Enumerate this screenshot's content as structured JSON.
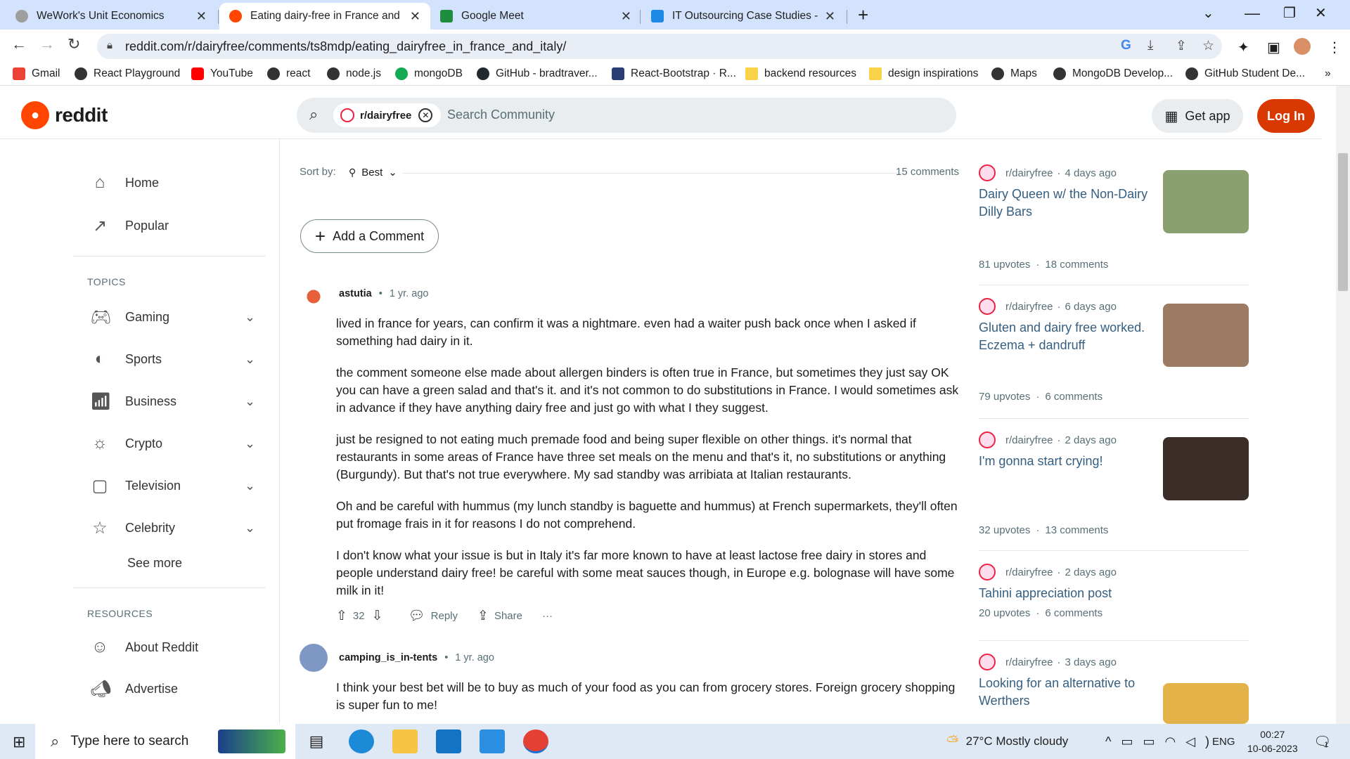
{
  "browser": {
    "tabs": [
      {
        "title": "WeWork's Unit Economics"
      },
      {
        "title": "Eating dairy-free in France and It"
      },
      {
        "title": "Google Meet"
      },
      {
        "title": "IT Outsourcing Case Studies - US"
      }
    ],
    "url": "reddit.com/r/dairyfree/comments/ts8mdp/eating_dairyfree_in_france_and_italy/",
    "bookmarks": [
      "Gmail",
      "React Playground",
      "YouTube",
      "react",
      "node.js",
      "mongoDB",
      "GitHub - bradtraver...",
      "React-Bootstrap · R...",
      "backend resources",
      "design inspirations",
      "Maps",
      "MongoDB Develop...",
      "GitHub Student De..."
    ]
  },
  "header": {
    "logo": "reddit",
    "community_chip": "r/dairyfree",
    "search_placeholder": "Search Community",
    "get_app": "Get app",
    "login": "Log In"
  },
  "sidebar": {
    "main": [
      {
        "label": "Home"
      },
      {
        "label": "Popular"
      }
    ],
    "topics_heading": "TOPICS",
    "topics": [
      {
        "label": "Gaming"
      },
      {
        "label": "Sports"
      },
      {
        "label": "Business"
      },
      {
        "label": "Crypto"
      },
      {
        "label": "Television"
      },
      {
        "label": "Celebrity"
      }
    ],
    "see_more": "See more",
    "resources_heading": "RESOURCES",
    "resources": [
      {
        "label": "About Reddit"
      },
      {
        "label": "Advertise"
      }
    ]
  },
  "thread": {
    "sort_label": "Sort by:",
    "sort_value": "Best",
    "comment_count": "15 comments",
    "add_comment": "Add a Comment",
    "comments": [
      {
        "author": "astutia",
        "time": "1 yr. ago",
        "paragraphs": [
          "lived in france for years, can confirm it was a nightmare. even had a waiter push back once when I asked if something had dairy in it.",
          "the comment someone else made about allergen binders is often true in France, but sometimes they just say OK you can have a green salad and that's it. and it's not common to do substitutions in France. I would sometimes ask in advance if they have anything dairy free and just go with what I they suggest.",
          "just be resigned to not eating much premade food and being super flexible on other things. it's normal that restaurants in some areas of France have three set meals on the menu and that's it, no substitutions or anything (Burgundy). But that's not true everywhere. My sad standby was arribiata at Italian restaurants.",
          "Oh and be careful with hummus (my lunch standby is baguette and hummus) at French supermarkets, they'll often put fromage frais in it for reasons I do not comprehend.",
          "I don't know what your issue is but in Italy it's far more known to have at least lactose free dairy in stores and people understand dairy free! be careful with some meat sauces though, in Europe e.g. bolognase will have some milk in it!"
        ],
        "votes": "32",
        "reply": "Reply",
        "share": "Share",
        "more": "···"
      },
      {
        "author": "camping_is_in-tents",
        "time": "1 yr. ago",
        "paragraphs": [
          "I think your best bet will be to buy as much of your food as you can from grocery stores. Foreign grocery shopping is super fun to me!"
        ]
      }
    ]
  },
  "related": [
    {
      "sub": "r/dairyfree",
      "time": "4 days ago",
      "title": "Dairy Queen w/ the Non-Dairy Dilly Bars",
      "upvotes": "81 upvotes",
      "comments": "18 comments",
      "thumb": "#8aa070"
    },
    {
      "sub": "r/dairyfree",
      "time": "6 days ago",
      "title": "Gluten and dairy free worked. Eczema + dandruff",
      "upvotes": "79 upvotes",
      "comments": "6 comments",
      "thumb": "#9b7b64"
    },
    {
      "sub": "r/dairyfree",
      "time": "2 days ago",
      "title": "I'm gonna start crying!",
      "upvotes": "32 upvotes",
      "comments": "13 comments",
      "thumb": "#3b2e28"
    },
    {
      "sub": "r/dairyfree",
      "time": "2 days ago",
      "title": "Tahini appreciation post",
      "upvotes": "20 upvotes",
      "comments": "6 comments",
      "thumb": ""
    },
    {
      "sub": "r/dairyfree",
      "time": "3 days ago",
      "title": "Looking for an alternative to Werthers",
      "upvotes": "",
      "comments": "",
      "thumb": "#e3b34a"
    }
  ],
  "taskbar": {
    "search_placeholder": "Type here to search",
    "weather": "27°C  Mostly cloudy",
    "lang": "ENG",
    "time": "00:27",
    "date": "10-06-2023",
    "notifications": "1"
  },
  "colors": {
    "accent": "#ff4500",
    "login": "#d93900",
    "link_title": "#355e80",
    "tab_strip": "#d3e3fd"
  }
}
